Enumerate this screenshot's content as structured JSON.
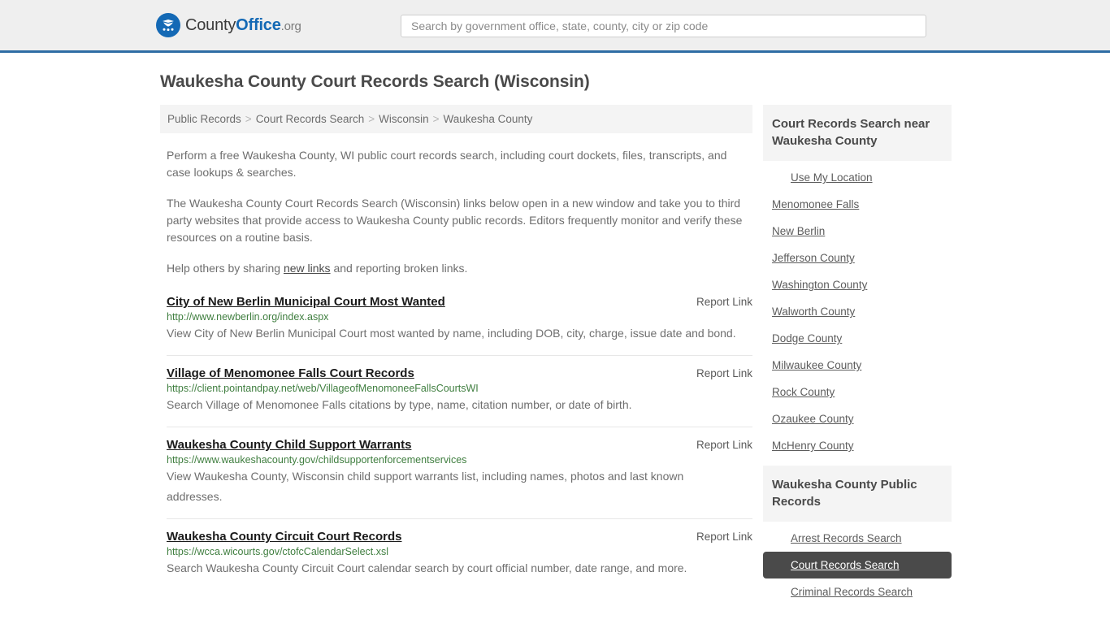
{
  "header": {
    "brand": {
      "county": "County",
      "office": "Office",
      "org": ".org",
      "icon": "eagle-stars-emblem"
    },
    "search": {
      "value": "",
      "placeholder": "Search by government office, state, county, city or zip code"
    },
    "accent_color": "#2e6da4",
    "background_color": "#efefef"
  },
  "page": {
    "title": "Waukesha County Court Records Search (Wisconsin)"
  },
  "breadcrumb": {
    "items": [
      {
        "label": "Public Records"
      },
      {
        "label": "Court Records Search"
      },
      {
        "label": "Wisconsin"
      },
      {
        "label": "Waukesha County"
      }
    ],
    "separator": ">"
  },
  "intro": {
    "paragraph1": "Perform a free Waukesha County, WI public court records search, including court dockets, files, transcripts, and case lookups & searches.",
    "paragraph2": "The Waukesha County Court Records Search (Wisconsin) links below open in a new window and take you to third party websites that provide access to Waukesha County public records. Editors frequently monitor and verify these resources on a routine basis.",
    "paragraph3_pre": "Help others by sharing ",
    "paragraph3_link": "new links",
    "paragraph3_post": " and reporting broken links."
  },
  "results": {
    "report_link_label": "Report Link",
    "items": [
      {
        "title": "City of New Berlin Municipal Court Most Wanted",
        "url": "http://www.newberlin.org/index.aspx",
        "description": "View City of New Berlin Municipal Court most wanted by name, including DOB, city, charge, issue date and bond."
      },
      {
        "title": "Village of Menomonee Falls Court Records",
        "url": "https://client.pointandpay.net/web/VillageofMenomoneeFallsCourtsWI",
        "description": "Search Village of Menomonee Falls citations by type, name, citation number, or date of birth."
      },
      {
        "title": "Waukesha County Child Support Warrants",
        "url": "https://www.waukeshacounty.gov/childsupportenforcementservices",
        "description": "View Waukesha County, Wisconsin child support warrants list, including names, photos and last known addresses."
      },
      {
        "title": "Waukesha County Circuit Court Records",
        "url": "https://wcca.wicourts.gov/ctofcCalendarSelect.xsl",
        "description": "Search Waukesha County Circuit Court calendar search by court official number, date range, and more."
      }
    ]
  },
  "sidebar": {
    "nearby": {
      "heading": "Court Records Search near Waukesha County",
      "items": [
        {
          "label": "Use My Location",
          "indent": true,
          "active": false
        },
        {
          "label": "Menomonee Falls",
          "indent": false,
          "active": false
        },
        {
          "label": "New Berlin",
          "indent": false,
          "active": false
        },
        {
          "label": "Jefferson County",
          "indent": false,
          "active": false
        },
        {
          "label": "Washington County",
          "indent": false,
          "active": false
        },
        {
          "label": "Walworth County",
          "indent": false,
          "active": false
        },
        {
          "label": "Dodge County",
          "indent": false,
          "active": false
        },
        {
          "label": "Milwaukee County",
          "indent": false,
          "active": false
        },
        {
          "label": "Rock County",
          "indent": false,
          "active": false
        },
        {
          "label": "Ozaukee County",
          "indent": false,
          "active": false
        },
        {
          "label": "McHenry County",
          "indent": false,
          "active": false
        }
      ]
    },
    "public_records": {
      "heading": "Waukesha County Public Records",
      "items": [
        {
          "label": "Arrest Records Search",
          "indent": true,
          "active": false
        },
        {
          "label": "Court Records Search",
          "indent": true,
          "active": true
        },
        {
          "label": "Criminal Records Search",
          "indent": true,
          "active": false
        }
      ]
    },
    "active_color": "#4a4a4a"
  }
}
